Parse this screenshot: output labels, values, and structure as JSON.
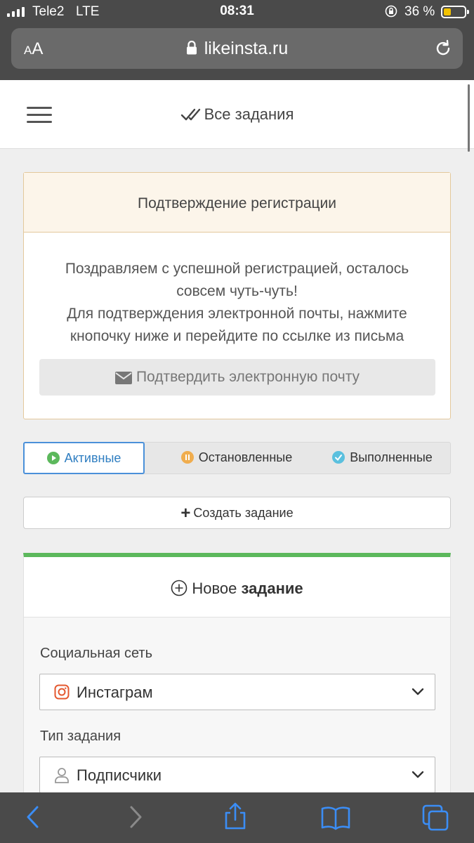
{
  "status": {
    "carrier": "Tele2",
    "network": "LTE",
    "time": "08:31",
    "battery": "36 %"
  },
  "browser": {
    "text_size": "AA",
    "url": "likeinsta.ru"
  },
  "header": {
    "title": "Все задания"
  },
  "confirm": {
    "title": "Подтверждение регистрации",
    "line1": "Поздравляем с успешной регистрацией, осталось",
    "line2": "совсем чуть-чуть!",
    "line3": "Для подтверждения электронной почты, нажмите",
    "line4": "кнопочку ниже и перейдите по ссылке из письма",
    "button": "Подтвердить электронную почту"
  },
  "tabs": [
    {
      "label": "Активные",
      "icon": "play-icon",
      "color": "#5cb85c"
    },
    {
      "label": "Остановленные",
      "icon": "pause-icon",
      "color": "#f0ad4e"
    },
    {
      "label": "Выполненные",
      "icon": "check-icon",
      "color": "#5bc0de"
    }
  ],
  "create": {
    "label": "Создать задание"
  },
  "new_task": {
    "title_normal": "Новое ",
    "title_bold": "задание",
    "social_label": "Социальная сеть",
    "social_value": "Инстаграм",
    "type_label": "Тип задания",
    "type_value": "Подписчики"
  },
  "colors": {
    "accent": "#4a90d9",
    "success": "#5cb85c",
    "warning_bg": "#fcf5ea",
    "chrome": "#4a4a4a"
  }
}
